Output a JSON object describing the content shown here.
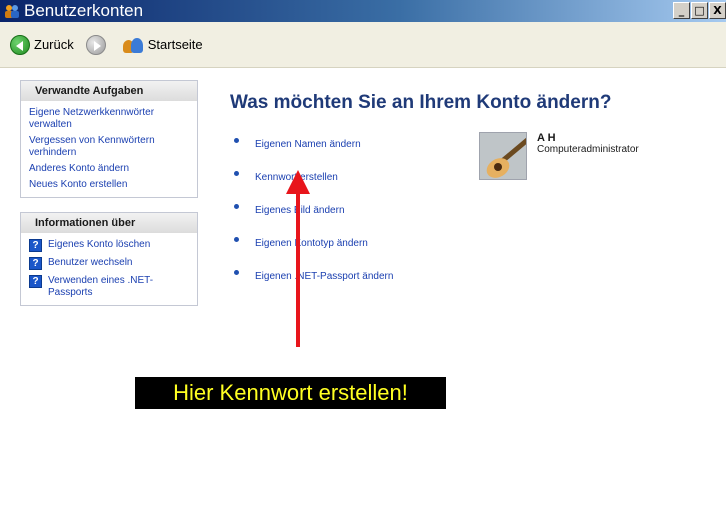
{
  "window": {
    "title": "Benutzerkonten",
    "controls": {
      "minimize": "_",
      "maximize": "□",
      "close": "X"
    }
  },
  "toolbar": {
    "back_label": "Zurück",
    "home_label": "Startseite"
  },
  "related_tasks": {
    "title": "Verwandte Aufgaben",
    "items": [
      "Eigene Netzwerkkennwörter verwalten",
      "Vergessen von Kennwörtern verhindern",
      "Anderes Konto ändern",
      "Neues Konto erstellen"
    ]
  },
  "info_about": {
    "title": "Informationen über",
    "items": [
      "Eigenes Konto löschen",
      "Benutzer wechseln",
      "Verwenden eines .NET-Passports"
    ]
  },
  "main": {
    "heading": "Was möchten Sie an Ihrem Konto ändern?",
    "options": [
      "Eigenen Namen ändern",
      "Kennwort erstellen",
      "Eigenes Bild ändern",
      "Eigenen Kontotyp ändern",
      "Eigenen .NET-Passport ändern"
    ]
  },
  "user": {
    "name": "A H",
    "role": "Computeradministrator"
  },
  "annotation": {
    "callout_text": "Hier Kennwort erstellen!",
    "color": "#e8151b",
    "callout_text_color": "#ffff22"
  },
  "icons": {
    "back": "back-arrow-icon",
    "forward": "forward-arrow-icon",
    "home": "users-icon",
    "help": "help-icon"
  }
}
